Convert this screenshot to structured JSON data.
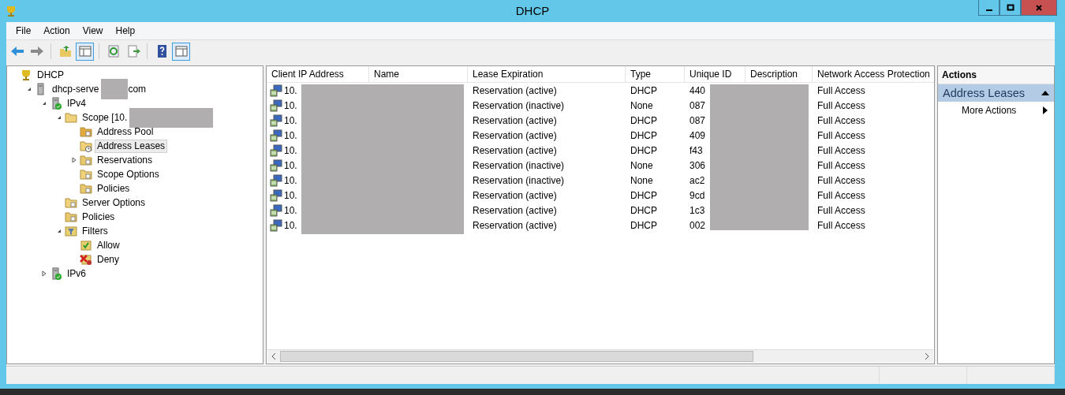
{
  "window": {
    "title": "DHCP"
  },
  "menu": [
    "File",
    "Action",
    "View",
    "Help"
  ],
  "toolbar": [
    {
      "kind": "back",
      "pressed": false
    },
    {
      "kind": "forward",
      "pressed": false
    },
    {
      "kind": "up",
      "pressed": false
    },
    {
      "kind": "tree",
      "pressed": true
    },
    {
      "kind": "refresh",
      "pressed": false
    },
    {
      "kind": "export",
      "pressed": false
    },
    {
      "kind": "help",
      "pressed": false
    },
    {
      "kind": "actions",
      "pressed": true
    }
  ],
  "tree": [
    {
      "label": "DHCP",
      "kind": "dhcp",
      "selected": false,
      "children": [
        {
          "label": "dhcp-serve",
          "label_after": "com",
          "redacted": true,
          "kind": "server",
          "expanded": true,
          "selected": false,
          "children": [
            {
              "label": "IPv4",
              "kind": "ip",
              "expanded": true,
              "selected": false,
              "children": [
                {
                  "label": "Scope [10.",
                  "redacted": true,
                  "kind": "folder",
                  "expanded": true,
                  "selected": false,
                  "children": [
                    {
                      "label": "Address Pool",
                      "kind": "pool",
                      "selected": false
                    },
                    {
                      "label": "Address Leases",
                      "kind": "leases",
                      "selected": true
                    },
                    {
                      "label": "Reservations",
                      "kind": "reservations",
                      "expanded": false,
                      "selected": false
                    },
                    {
                      "label": "Scope Options",
                      "kind": "options",
                      "selected": false
                    },
                    {
                      "label": "Policies",
                      "kind": "policies",
                      "selected": false
                    }
                  ]
                },
                {
                  "label": "Server Options",
                  "kind": "options",
                  "selected": false
                },
                {
                  "label": "Policies",
                  "kind": "policies",
                  "selected": false
                },
                {
                  "label": "Filters",
                  "kind": "filters",
                  "expanded": true,
                  "selected": false,
                  "children": [
                    {
                      "label": "Allow",
                      "kind": "allow",
                      "selected": false
                    },
                    {
                      "label": "Deny",
                      "kind": "deny",
                      "selected": false
                    }
                  ]
                }
              ]
            },
            {
              "label": "IPv6",
              "kind": "ip",
              "expanded": false,
              "selected": false
            }
          ]
        }
      ]
    }
  ],
  "table": {
    "columns": [
      "Client IP Address",
      "Name",
      "Lease Expiration",
      "Type",
      "Unique ID",
      "Description",
      "Network Access Protection"
    ],
    "rows": [
      {
        "ip": "10.",
        "lease": "Reservation (active)",
        "type": "DHCP",
        "uid": "440",
        "nap": "Full Access"
      },
      {
        "ip": "10.",
        "lease": "Reservation (inactive)",
        "type": "None",
        "uid": "087",
        "nap": "Full Access"
      },
      {
        "ip": "10.",
        "lease": "Reservation (active)",
        "type": "DHCP",
        "uid": "087",
        "nap": "Full Access"
      },
      {
        "ip": "10.",
        "lease": "Reservation (active)",
        "type": "DHCP",
        "uid": "409",
        "nap": "Full Access"
      },
      {
        "ip": "10.",
        "lease": "Reservation (active)",
        "type": "DHCP",
        "uid": "f43",
        "nap": "Full Access"
      },
      {
        "ip": "10.",
        "lease": "Reservation (inactive)",
        "type": "None",
        "uid": "306",
        "nap": "Full Access"
      },
      {
        "ip": "10.",
        "lease": "Reservation (inactive)",
        "type": "None",
        "uid": "ac2",
        "nap": "Full Access"
      },
      {
        "ip": "10.",
        "lease": "Reservation (active)",
        "type": "DHCP",
        "uid": "9cd",
        "nap": "Full Access"
      },
      {
        "ip": "10.",
        "lease": "Reservation (active)",
        "type": "DHCP",
        "uid": "1c3",
        "nap": "Full Access"
      },
      {
        "ip": "10.",
        "lease": "Reservation (active)",
        "type": "DHCP",
        "uid": "002",
        "nap": "Full Access"
      }
    ]
  },
  "actions": {
    "title": "Actions",
    "section": "Address Leases",
    "items": [
      "More Actions"
    ]
  }
}
